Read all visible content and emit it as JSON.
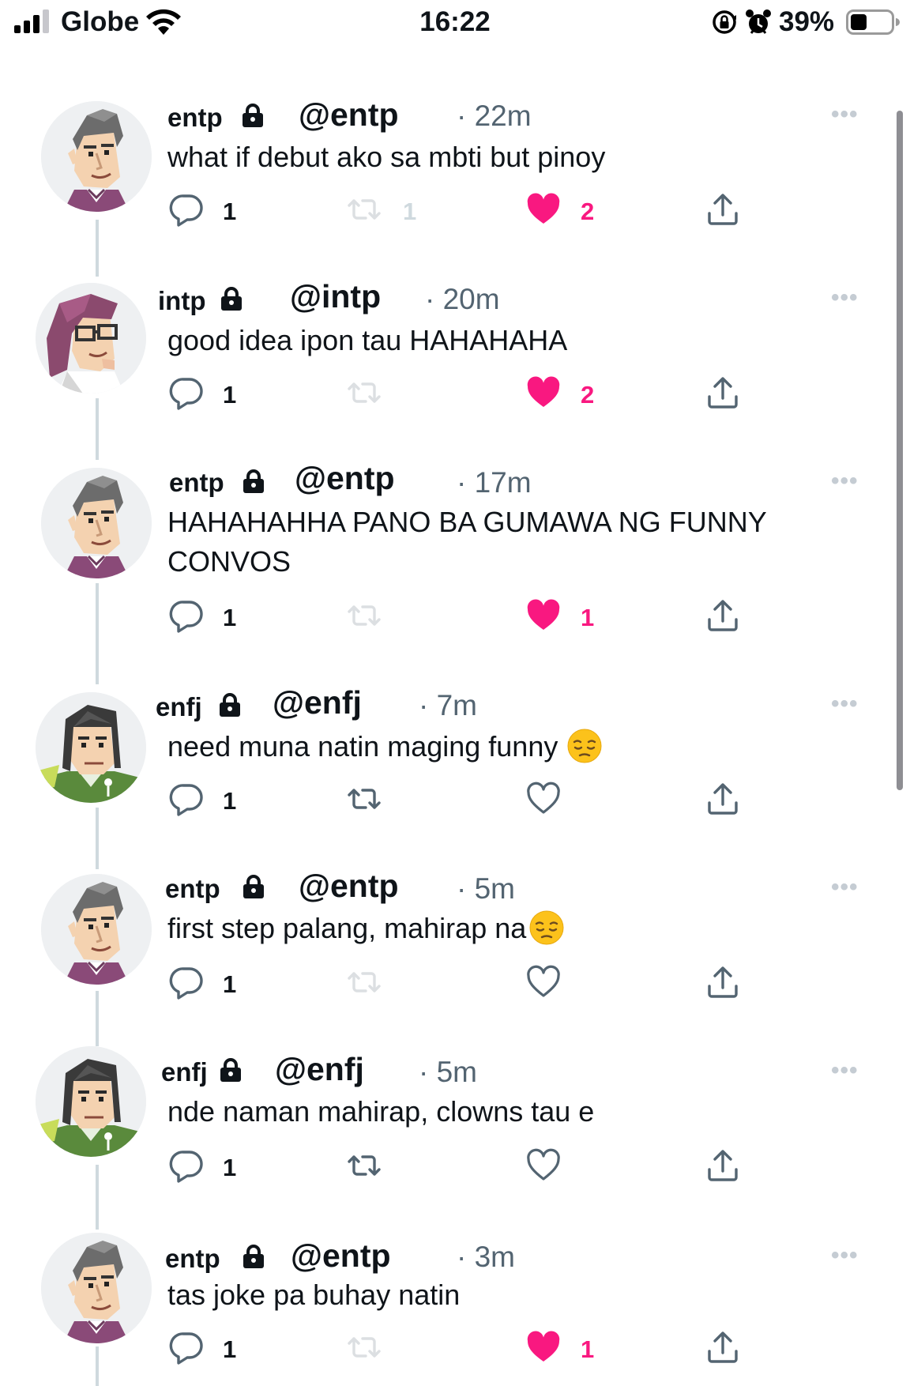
{
  "status_bar": {
    "carrier": "Globe",
    "time": "16:22",
    "battery": "39%",
    "icons": [
      "signal-icon",
      "wifi-icon",
      "orientation-lock-icon",
      "alarm-icon",
      "battery-icon"
    ]
  },
  "colors": {
    "like_active": "#f91880",
    "muted": "#536471",
    "text": "#0f1419",
    "thread_line": "#cfd9de"
  },
  "tweets": [
    {
      "name": "entp",
      "handle": "@entp",
      "time": "· 22m",
      "text": "what if debut ako sa mbti but pinoy",
      "replies": "1",
      "retweets": "1",
      "likes": "2",
      "liked": true,
      "retweet_muted": true,
      "avatar": "entp-avatar"
    },
    {
      "name": "intp",
      "handle": "@intp",
      "time": "· 20m",
      "text": "good idea ipon tau HAHAHAHA",
      "replies": "1",
      "retweets": "",
      "likes": "2",
      "liked": true,
      "retweet_muted": true,
      "avatar": "intp-avatar"
    },
    {
      "name": "entp",
      "handle": "@entp",
      "time": "· 17m",
      "text": "HAHAHAHHA PANO BA GUMAWA NG FUNNY CONVOS",
      "replies": "1",
      "retweets": "",
      "likes": "1",
      "liked": true,
      "retweet_muted": true,
      "avatar": "entp-avatar"
    },
    {
      "name": "enfj",
      "handle": "@enfj",
      "time": "· 7m",
      "text": "need muna natin maging funny",
      "emoji": "pensive-face-emoji",
      "replies": "1",
      "retweets": "",
      "likes": "",
      "liked": false,
      "retweet_muted": false,
      "avatar": "enfj-avatar"
    },
    {
      "name": "entp",
      "handle": "@entp",
      "time": "· 5m",
      "text": "first step palang, mahirap na",
      "emoji": "pensive-face-emoji",
      "replies": "1",
      "retweets": "",
      "likes": "",
      "liked": false,
      "retweet_muted": true,
      "avatar": "entp-avatar"
    },
    {
      "name": "enfj",
      "handle": "@enfj",
      "time": "· 5m",
      "text": "nde naman mahirap, clowns tau e",
      "replies": "1",
      "retweets": "",
      "likes": "",
      "liked": false,
      "retweet_muted": false,
      "avatar": "enfj-avatar"
    },
    {
      "name": "entp",
      "handle": "@entp",
      "time": "· 3m",
      "text": "tas joke pa buhay natin",
      "replies": "1",
      "retweets": "",
      "likes": "1",
      "liked": true,
      "retweet_muted": true,
      "avatar": "entp-avatar"
    }
  ]
}
